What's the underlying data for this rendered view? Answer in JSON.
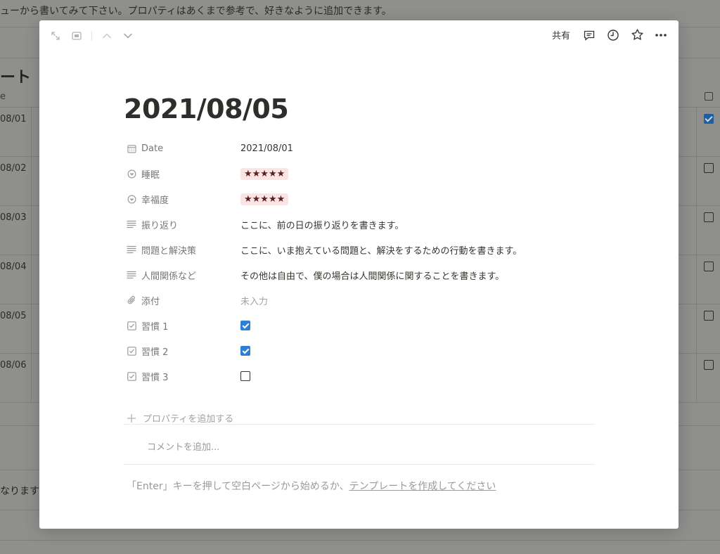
{
  "background": {
    "top_text": "ューから書いてみて下さい。プロパティはあくまで参考で、好きなように追加できます。",
    "section_title": "ート",
    "col_header": "e",
    "rows": [
      {
        "date": "08/01",
        "checked": true
      },
      {
        "date": "08/02",
        "checked": false
      },
      {
        "date": "08/03",
        "checked": false
      },
      {
        "date": "08/04",
        "checked": false
      },
      {
        "date": "08/05",
        "checked": false
      },
      {
        "date": "08/06",
        "checked": false
      }
    ],
    "bottom_text": "なります"
  },
  "topbar": {
    "share_label": "共有"
  },
  "page": {
    "title": "2021/08/05",
    "properties": [
      {
        "name": "Date",
        "icon": "calendar-icon",
        "type": "date",
        "value": "2021/08/01"
      },
      {
        "name": "睡眠",
        "icon": "select-icon",
        "type": "select",
        "value": "★★★★★"
      },
      {
        "name": "幸福度",
        "icon": "select-icon",
        "type": "select",
        "value": "★★★★★"
      },
      {
        "name": "振り返り",
        "icon": "text-icon",
        "type": "text",
        "value": "ここに、前の日の振り返りを書きます。"
      },
      {
        "name": "問題と解決策",
        "icon": "text-icon",
        "type": "text",
        "value": "ここに、いま抱えている問題と、解決をするための行動を書きます。"
      },
      {
        "name": "人間関係など",
        "icon": "text-icon",
        "type": "text",
        "value": "その他は自由で、僕の場合は人間関係に関することを書きます。"
      },
      {
        "name": "添付",
        "icon": "paperclip-icon",
        "type": "file",
        "value": "未入力"
      },
      {
        "name": "習慣 1",
        "icon": "checkbox-icon",
        "type": "checkbox",
        "checked": true
      },
      {
        "name": "習慣 2",
        "icon": "checkbox-icon",
        "type": "checkbox",
        "checked": true
      },
      {
        "name": "習慣 3",
        "icon": "checkbox-icon",
        "type": "checkbox",
        "checked": false
      }
    ],
    "add_property_label": "プロパティを追加する",
    "comment_placeholder": "コメントを追加...",
    "hint_prefix": "「Enter」キーを押して空白ページから始めるか、",
    "hint_link": "テンプレートを作成してください"
  },
  "colors": {
    "accent": "#2e7fd6",
    "star_bg": "#fbe4e4",
    "star_fg": "#5c1f1f"
  }
}
